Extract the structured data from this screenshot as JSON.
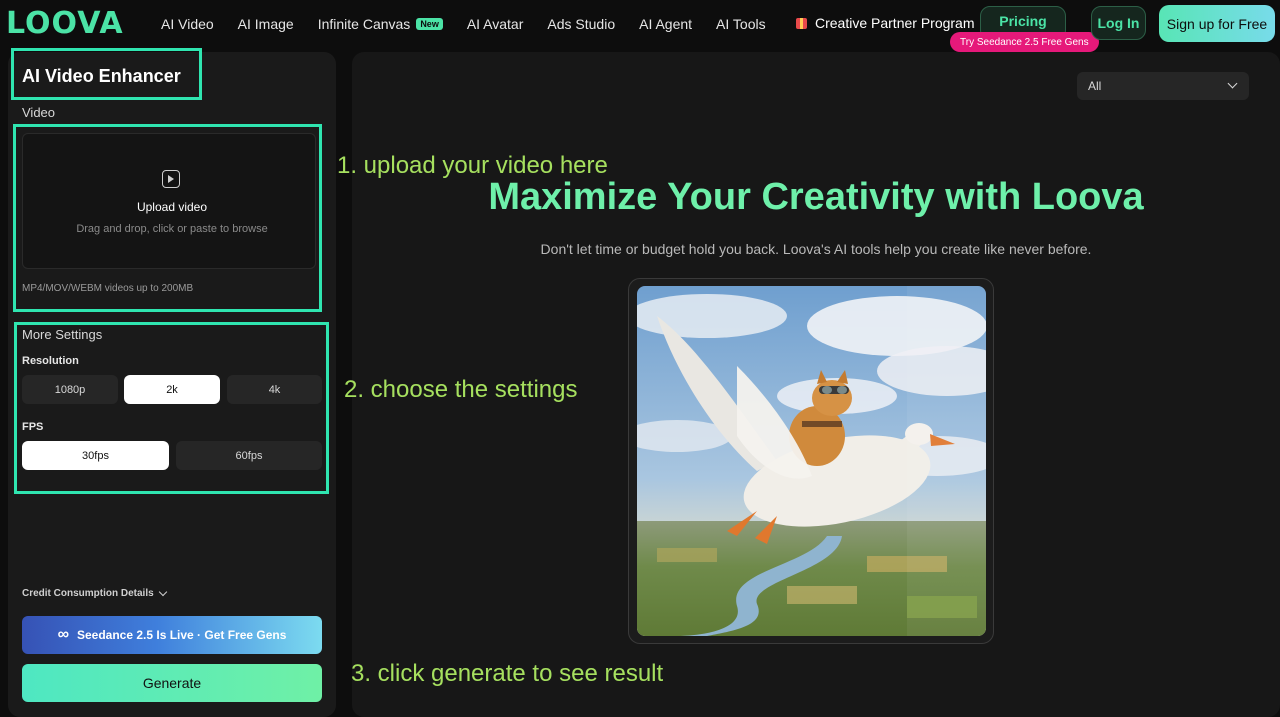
{
  "brand": {
    "logo_text": "LOOVA"
  },
  "nav": {
    "links": [
      {
        "label": "AI Video"
      },
      {
        "label": "AI Image"
      },
      {
        "label": "Infinite Canvas",
        "badge": "New"
      },
      {
        "label": "AI Avatar"
      },
      {
        "label": "Ads Studio"
      },
      {
        "label": "AI Agent"
      },
      {
        "label": "AI Tools"
      }
    ],
    "partner_label": "Creative Partner Program",
    "pricing_label": "Pricing",
    "pricing_promo": "Try Seedance 2.5 Free Gens",
    "login_label": "Log In",
    "signup_label": "Sign up for Free"
  },
  "tool": {
    "title": "AI Video Enhancer",
    "video_label": "Video",
    "upload_title": "Upload video",
    "upload_sub": "Drag and drop, click or paste to browse",
    "upload_hint": "MP4/MOV/WEBM videos up to 200MB",
    "more_settings_label": "More Settings",
    "resolution_label": "Resolution",
    "resolution_options": [
      "1080p",
      "2k",
      "4k"
    ],
    "resolution_selected": "2k",
    "fps_label": "FPS",
    "fps_options": [
      "30fps",
      "60fps"
    ],
    "fps_selected": "30fps",
    "credit_label": "Credit Consumption Details",
    "promo_label": "Seedance 2.5 Is Live · Get Free Gens",
    "generate_label": "Generate"
  },
  "main": {
    "filter_value": "All",
    "hero_title": "Maximize Your Creativity with Loova",
    "hero_subtitle": "Don't let time or budget hold you back. Loova's AI tools help you create like never before."
  },
  "annotations": {
    "step1": "1. upload your video here",
    "step2": "2. choose the settings",
    "step3": "3. click generate to see result"
  },
  "colors": {
    "accent": "#4be3a6",
    "annotation_box": "#2fe5b0",
    "annotation_text": "#a6e05f",
    "promo_pink": "#e6197a"
  }
}
